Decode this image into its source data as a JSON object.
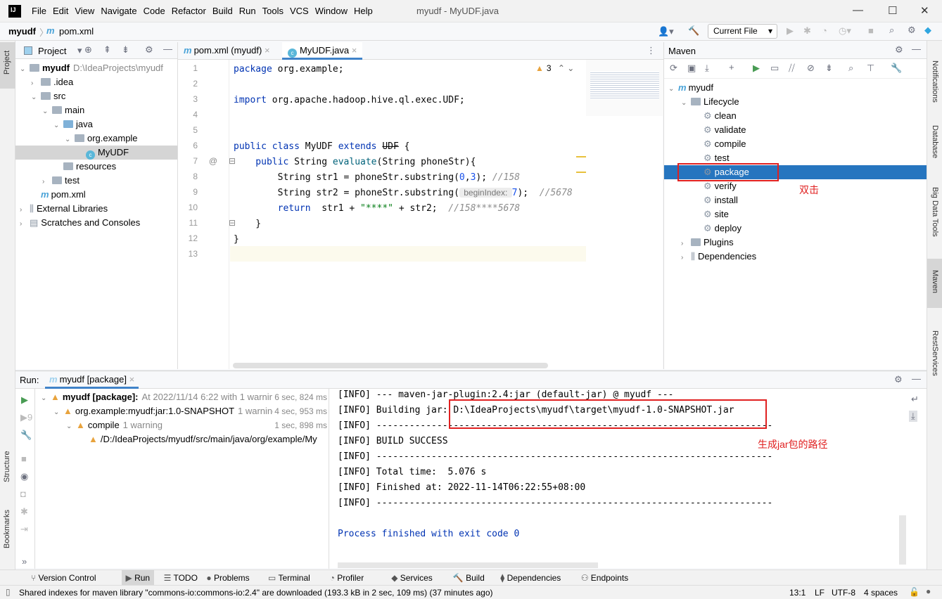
{
  "menu": [
    "File",
    "Edit",
    "View",
    "Navigate",
    "Code",
    "Refactor",
    "Build",
    "Run",
    "Tools",
    "VCS",
    "Window",
    "Help"
  ],
  "window_title": "myudf - MyUDF.java",
  "logo": "IJ",
  "nav": {
    "project": "myudf",
    "file": "pom.xml",
    "run_config": "Current File"
  },
  "left_stripe": {
    "project": "Project",
    "structure": "Structure",
    "bookmarks": "Bookmarks"
  },
  "right_stripe": {
    "notifications": "Notifications",
    "database": "Database",
    "bigdata": "Big Data Tools",
    "maven": "Maven",
    "rest": "RestServices"
  },
  "project_panel": {
    "title": "Project",
    "tree": [
      {
        "label": "myudf",
        "extra": "D:\\IdeaProjects\\myudf",
        "bold": true,
        "depth": 0,
        "chev": "v",
        "icon": "module"
      },
      {
        "label": ".idea",
        "depth": 1,
        "chev": ">",
        "icon": "folder"
      },
      {
        "label": "src",
        "depth": 1,
        "chev": "v",
        "icon": "folder"
      },
      {
        "label": "main",
        "depth": 2,
        "chev": "v",
        "icon": "folder"
      },
      {
        "label": "java",
        "depth": 3,
        "chev": "v",
        "icon": "folder-blue"
      },
      {
        "label": "org.example",
        "depth": 4,
        "chev": "v",
        "icon": "package"
      },
      {
        "label": "MyUDF",
        "depth": 5,
        "chev": "",
        "icon": "class",
        "selected": true
      },
      {
        "label": "resources",
        "depth": 3,
        "chev": "",
        "icon": "folder"
      },
      {
        "label": "test",
        "depth": 2,
        "chev": ">",
        "icon": "folder"
      },
      {
        "label": "pom.xml",
        "depth": 1,
        "chev": "",
        "icon": "maven"
      },
      {
        "label": "External Libraries",
        "depth": 0,
        "chev": ">",
        "icon": "library"
      },
      {
        "label": "Scratches and Consoles",
        "depth": 0,
        "chev": ">",
        "icon": "scratch"
      }
    ]
  },
  "editor": {
    "tabs": [
      {
        "label": "pom.xml (myudf)",
        "icon": "maven"
      },
      {
        "label": "MyUDF.java",
        "icon": "class",
        "active": true
      }
    ],
    "warnings": "3",
    "lines": [
      [
        [
          "package ",
          "kw"
        ],
        [
          "org.example;",
          "plain"
        ]
      ],
      [],
      [
        [
          "import ",
          "kw"
        ],
        [
          "org.apache.hadoop.hive.ql.exec.UDF;",
          "plain"
        ]
      ],
      [],
      [],
      [
        [
          "public class ",
          "kw"
        ],
        [
          "MyUDF ",
          "plain"
        ],
        [
          "extends ",
          "kw"
        ],
        [
          "UDF",
          "strike"
        ],
        [
          " {",
          "plain"
        ]
      ],
      [
        [
          "    public ",
          "kw"
        ],
        [
          "String ",
          "plain"
        ],
        [
          "evaluate",
          "fn"
        ],
        [
          "(String phoneStr){",
          "plain"
        ]
      ],
      [
        [
          "        String str1 = phoneStr.substring(",
          "plain"
        ],
        [
          "0",
          "num"
        ],
        [
          ",",
          "plain"
        ],
        [
          "3",
          "num"
        ],
        [
          "); ",
          "plain"
        ],
        [
          "//158",
          "cm"
        ]
      ],
      [
        [
          "        String str2 = phoneStr.substring(",
          "plain"
        ],
        [
          " beginIndex: ",
          "hint"
        ],
        [
          "7",
          "num"
        ],
        [
          ");  ",
          "plain"
        ],
        [
          "//5678",
          "cm"
        ]
      ],
      [
        [
          "        return  ",
          "kw"
        ],
        [
          "str1 + ",
          "plain"
        ],
        [
          "\"****\"",
          "str"
        ],
        [
          " + str2;  ",
          "plain"
        ],
        [
          "//158****5678",
          "cm"
        ]
      ],
      [
        [
          "    }",
          "plain"
        ]
      ],
      [
        [
          "}",
          "plain"
        ]
      ],
      []
    ]
  },
  "maven": {
    "title": "Maven",
    "tree": [
      {
        "label": "myudf",
        "depth": 0,
        "chev": "v",
        "icon": "maven"
      },
      {
        "label": "Lifecycle",
        "depth": 1,
        "chev": "v",
        "icon": "folder"
      },
      {
        "label": "clean",
        "depth": 2,
        "icon": "gear"
      },
      {
        "label": "validate",
        "depth": 2,
        "icon": "gear"
      },
      {
        "label": "compile",
        "depth": 2,
        "icon": "gear"
      },
      {
        "label": "test",
        "depth": 2,
        "icon": "gear"
      },
      {
        "label": "package",
        "depth": 2,
        "icon": "gear",
        "selected": true
      },
      {
        "label": "verify",
        "depth": 2,
        "icon": "gear"
      },
      {
        "label": "install",
        "depth": 2,
        "icon": "gear"
      },
      {
        "label": "site",
        "depth": 2,
        "icon": "gear"
      },
      {
        "label": "deploy",
        "depth": 2,
        "icon": "gear"
      },
      {
        "label": "Plugins",
        "depth": 1,
        "chev": ">",
        "icon": "folder"
      },
      {
        "label": "Dependencies",
        "depth": 1,
        "chev": ">",
        "icon": "library"
      }
    ],
    "annotation": "双击"
  },
  "run": {
    "label": "Run:",
    "tab": "myudf [package]",
    "tree": [
      {
        "label": "myudf [package]:",
        "extra": "At 2022/11/14 6:22 with 1 warnir",
        "time": "6 sec, 824 ms",
        "depth": 0,
        "bold": true
      },
      {
        "label": "org.example:myudf:jar:1.0-SNAPSHOT",
        "extra": "1 warning",
        "time": "4 sec, 953 ms",
        "depth": 1
      },
      {
        "label": "compile",
        "extra": "1 warning",
        "time": "1 sec, 898 ms",
        "depth": 2
      },
      {
        "label": "/D:/IdeaProjects/myudf/src/main/java/org/example/My",
        "extra": "",
        "time": "",
        "depth": 3
      }
    ],
    "console": [
      "[INFO] --- maven-jar-plugin:2.4:jar (default-jar) @ myudf ---",
      "[INFO] Building jar: D:\\IdeaProjects\\myudf\\target\\myudf-1.0-SNAPSHOT.jar",
      "[INFO] ------------------------------------------------------------------------",
      "[INFO] BUILD SUCCESS",
      "[INFO] ------------------------------------------------------------------------",
      "[INFO] Total time:  5.076 s",
      "[INFO] Finished at: 2022-11-14T06:22:55+08:00",
      "[INFO] ------------------------------------------------------------------------",
      "",
      "Process finished with exit code 0"
    ],
    "annotation": "生成jar包的路径"
  },
  "bottom_tabs": [
    "Version Control",
    "Run",
    "TODO",
    "Problems",
    "Terminal",
    "Profiler",
    "Services",
    "Build",
    "Dependencies",
    "Endpoints"
  ],
  "status": {
    "message": "Shared indexes for maven library \"commons-io:commons-io:2.4\" are downloaded (193.3 kB in 2 sec, 109 ms) (37 minutes ago)",
    "position": "13:1",
    "line_sep": "LF",
    "encoding": "UTF-8",
    "indent": "4 spaces"
  },
  "colors": {
    "selection": "#2675bf",
    "annotation": "#e02020",
    "keyword": "#0033b3"
  }
}
